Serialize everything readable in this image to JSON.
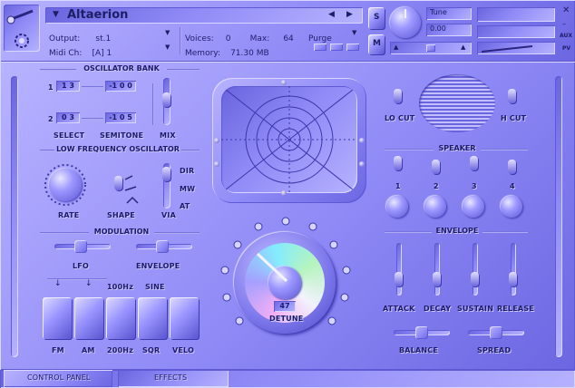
{
  "header": {
    "instrument_name": "Altaerion",
    "output_label": "Output:",
    "output_value": "st.1",
    "voices_label": "Voices:",
    "voices_value": "0",
    "max_label": "Max:",
    "max_value": "64",
    "purge_label": "Purge",
    "midi_label": "Midi Ch:",
    "midi_value": "[A] 1",
    "memory_label": "Memory:",
    "memory_value": "71.30 MB",
    "tune_label": "Tune",
    "tune_value": "0.00",
    "side_labels": [
      "AUX",
      "PV"
    ],
    "s_label": "S",
    "m_label": "M"
  },
  "oscillator_bank": {
    "title": "OSCILLATOR BANK",
    "row1_index": "1",
    "row2_index": "2",
    "osc1_select": "1 3",
    "osc1_semitone": "-1 0 0",
    "osc2_select": "0 3",
    "osc2_semitone": "-1 0 5",
    "select_label": "SELECT",
    "semitone_label": "SEMITONE",
    "mix_label": "MIX"
  },
  "lfo": {
    "title": "LOW FREQUENCY OSCILLATOR",
    "rate_label": "RATE",
    "shape_label": "SHAPE",
    "via_label": "VIA",
    "dir_label": "DIR",
    "mw_label": "MW",
    "at_label": "AT"
  },
  "modulation": {
    "title": "MODULATION",
    "lfo_label": "LFO",
    "envelope_label": "ENVELOPE"
  },
  "pads": {
    "top_labels": [
      "100Hz",
      "SINE"
    ],
    "labels": [
      "FM",
      "AM",
      "200Hz",
      "SQR",
      "VELO"
    ]
  },
  "detune": {
    "value": "47",
    "label": "DETUNE"
  },
  "filter": {
    "lo_cut_label": "LO CUT",
    "hi_cut_label": "H CUT"
  },
  "speaker": {
    "title": "SPEAKER",
    "numbers": [
      "1",
      "2",
      "3",
      "4"
    ]
  },
  "envelope": {
    "title": "ENVELOPE",
    "attack_label": "ATTACK",
    "decay_label": "DECAY",
    "sustain_label": "SUSTAIN",
    "release_label": "RELEASE"
  },
  "mixer": {
    "balance_label": "BALANCE",
    "spread_label": "SPREAD"
  },
  "tabs": {
    "control_panel": "CONTROL PANEL",
    "effects": "EFFECTS"
  }
}
